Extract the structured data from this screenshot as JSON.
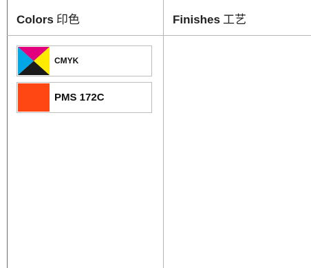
{
  "colors_column": {
    "title_en": "Colors",
    "title_cn": "印色",
    "swatches": [
      {
        "label": "CMYK",
        "icon": "cmyk-swatch-icon",
        "colors": {
          "cyan": "#00a6e6",
          "magenta": "#e3007e",
          "yellow": "#ffeb00",
          "black": "#1a1a1a"
        }
      },
      {
        "label": "PMS 172C",
        "icon": "pms-swatch-icon",
        "color": "#ff4713"
      }
    ]
  },
  "finishes_column": {
    "title_en": "Finishes",
    "title_cn": "工艺"
  }
}
